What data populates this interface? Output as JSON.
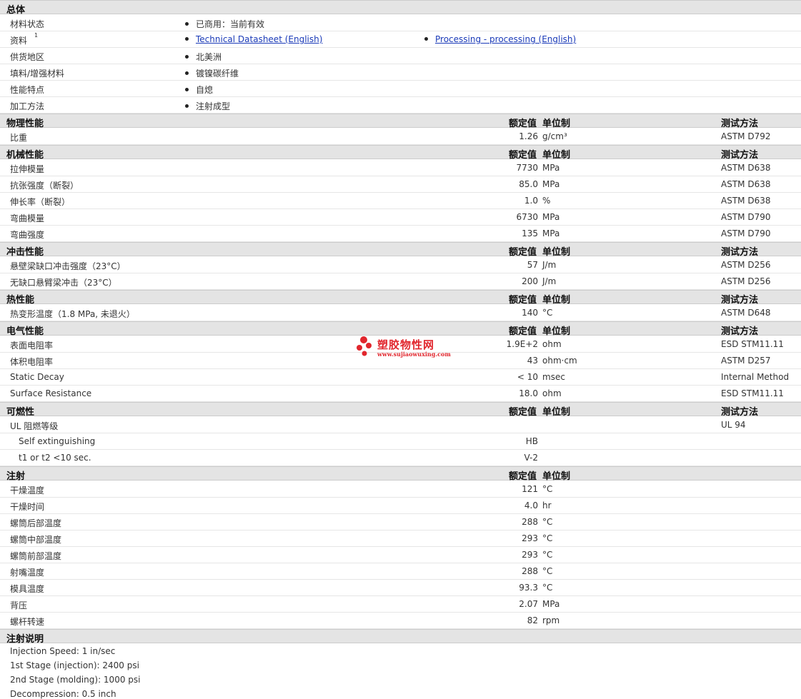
{
  "headers": {
    "value": "额定值",
    "unit": "单位制",
    "method": "测试方法"
  },
  "general": {
    "title": "总体",
    "rows": [
      {
        "label": "材料状态",
        "items": [
          "已商用：当前有效"
        ]
      },
      {
        "label": "资料",
        "sup": "1",
        "links": [
          "Technical Datasheet (English)",
          "Processing - processing (English)"
        ]
      },
      {
        "label": "供货地区",
        "items": [
          "北美洲"
        ]
      },
      {
        "label": "填料/增强材料",
        "items": [
          "镀镍碳纤维"
        ]
      },
      {
        "label": "性能特点",
        "items": [
          "自熄"
        ]
      },
      {
        "label": "加工方法",
        "items": [
          "注射成型"
        ]
      }
    ]
  },
  "sections": [
    {
      "title": "物理性能",
      "method_header": true,
      "rows": [
        {
          "name": "比重",
          "value": "1.26",
          "unit": "g/cm³",
          "method": "ASTM D792"
        }
      ]
    },
    {
      "title": "机械性能",
      "method_header": true,
      "rows": [
        {
          "name": "拉伸模量",
          "value": "7730",
          "unit": "MPa",
          "method": "ASTM D638"
        },
        {
          "name": "抗张强度（断裂）",
          "value": "85.0",
          "unit": "MPa",
          "method": "ASTM D638"
        },
        {
          "name": "伸长率（断裂）",
          "value": "1.0",
          "unit": "%",
          "method": "ASTM D638"
        },
        {
          "name": "弯曲模量",
          "value": "6730",
          "unit": "MPa",
          "method": "ASTM D790"
        },
        {
          "name": "弯曲强度",
          "value": "135",
          "unit": "MPa",
          "method": "ASTM D790"
        }
      ]
    },
    {
      "title": "冲击性能",
      "method_header": true,
      "rows": [
        {
          "name": "悬壁梁缺口冲击强度（23°C）",
          "value": "57",
          "unit": "J/m",
          "method": "ASTM D256"
        },
        {
          "name": "无缺口悬臂梁冲击（23°C）",
          "value": "200",
          "unit": "J/m",
          "method": "ASTM D256"
        }
      ]
    },
    {
      "title": "热性能",
      "method_header": true,
      "rows": [
        {
          "name": "热变形温度（1.8 MPa, 未退火）",
          "value": "140",
          "unit": "°C",
          "method": "ASTM D648"
        }
      ]
    },
    {
      "title": "电气性能",
      "method_header": true,
      "rows": [
        {
          "name": "表面电阻率",
          "value": "1.9E+2",
          "unit": "ohm",
          "method": "ESD STM11.11"
        },
        {
          "name": "体积电阻率",
          "value": "43",
          "unit": "ohm·cm",
          "method": "ASTM D257"
        },
        {
          "name": "Static Decay",
          "value": "< 10",
          "unit": "msec",
          "method": "Internal Method"
        },
        {
          "name": "Surface Resistance",
          "value": "18.0",
          "unit": "ohm",
          "method": "ESD STM11.11"
        }
      ]
    },
    {
      "title": "可燃性",
      "method_header": true,
      "rows": [
        {
          "name": "UL 阻燃等级",
          "value": "",
          "unit": "",
          "method": "UL 94"
        },
        {
          "name": "Self extinguishing",
          "value": "HB",
          "unit": "",
          "method": "",
          "sub": true
        },
        {
          "name": "t1 or t2 <10 sec.",
          "value": "V-2",
          "unit": "",
          "method": "",
          "sub": true
        }
      ]
    },
    {
      "title": "注射",
      "method_header": false,
      "rows": [
        {
          "name": "干燥温度",
          "value": "121",
          "unit": "°C",
          "method": ""
        },
        {
          "name": "干燥时间",
          "value": "4.0",
          "unit": "hr",
          "method": ""
        },
        {
          "name": "螺筒后部温度",
          "value": "288",
          "unit": "°C",
          "method": ""
        },
        {
          "name": "螺筒中部温度",
          "value": "293",
          "unit": "°C",
          "method": ""
        },
        {
          "name": "螺筒前部温度",
          "value": "293",
          "unit": "°C",
          "method": ""
        },
        {
          "name": "射嘴温度",
          "value": "288",
          "unit": "°C",
          "method": ""
        },
        {
          "name": "模具温度",
          "value": "93.3",
          "unit": "°C",
          "method": ""
        },
        {
          "name": "背压",
          "value": "2.07",
          "unit": "MPa",
          "method": ""
        },
        {
          "name": "螺杆转速",
          "value": "82",
          "unit": "rpm",
          "method": ""
        }
      ]
    }
  ],
  "notes": {
    "title": "注射说明",
    "lines": [
      "Injection Speed: 1 in/sec",
      "1st Stage (injection): 2400 psi",
      "2nd Stage (molding): 1000 psi",
      "Decompression: 0.5 inch"
    ]
  },
  "watermark": {
    "title": "塑胶物性网",
    "url": "www.sujiaowuxing.com",
    "color": "#e1262d"
  }
}
